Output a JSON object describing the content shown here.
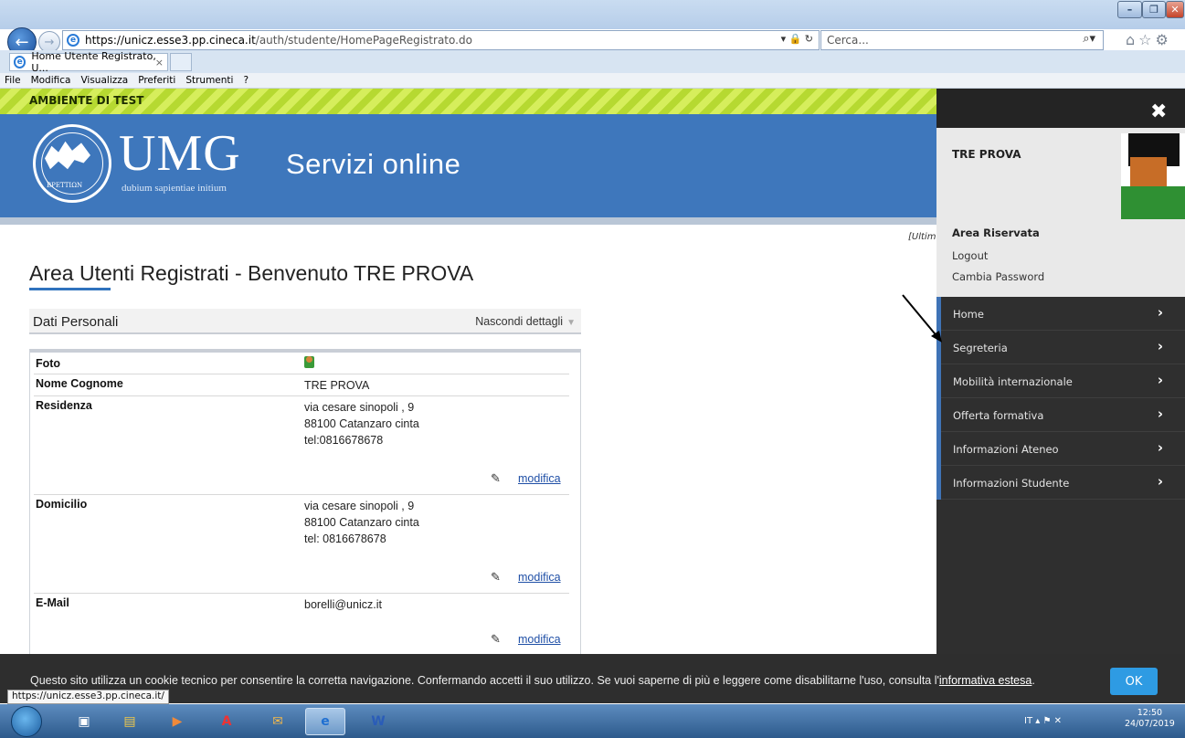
{
  "browser": {
    "url_prefix": "https://unicz.esse3.pp.",
    "url_domain": "cineca.it",
    "url_path": "/auth/studente/HomePageRegistrato.do",
    "search_placeholder": "Cerca...",
    "tab_title": "Home Utente Registrato, U...",
    "tab_close": "×",
    "menu": [
      "File",
      "Modifica",
      "Visualizza",
      "Preferiti",
      "Strumenti",
      "?"
    ],
    "status_url": "https://unicz.esse3.pp.cineca.it/"
  },
  "page": {
    "test_banner": "AMBIENTE DI TEST",
    "logo_text": "UMG",
    "logo_motto": "dubium sapientiae initium",
    "seal_text": "BPETTIΩN",
    "site_title": "Servizi online",
    "last_access_partial": "[Ultim",
    "heading": "Area Utenti Registrati - Benvenuto TRE PROVA",
    "section_title": "Dati Personali",
    "section_toggle": "Nascondi dettagli",
    "rows": {
      "foto": {
        "label": "Foto"
      },
      "nome": {
        "label": "Nome Cognome",
        "value": "TRE PROVA"
      },
      "residenza": {
        "label": "Residenza",
        "line1": "via cesare sinopoli , 9",
        "line2": "88100 Catanzaro cinta",
        "line3": "tel:0816678678",
        "edit": "modifica"
      },
      "domicilio": {
        "label": "Domicilio",
        "line1": "via cesare sinopoli , 9",
        "line2": "88100 Catanzaro cinta",
        "line3": "tel: 0816678678",
        "edit": "modifica"
      },
      "email": {
        "label": "E-Mail",
        "value": "borelli@unicz.it",
        "edit": "modifica"
      }
    }
  },
  "sidebar": {
    "close": "✖",
    "username": "TRE PROVA",
    "area_title": "Area Riservata",
    "logout": "Logout",
    "change_password": "Cambia Password",
    "items": [
      {
        "label": "Home"
      },
      {
        "label": "Segreteria"
      },
      {
        "label": "Mobilità internazionale"
      },
      {
        "label": "Offerta formativa"
      },
      {
        "label": "Informazioni Ateneo"
      },
      {
        "label": "Informazioni Studente"
      }
    ],
    "chevron": "›"
  },
  "cookie": {
    "text": "Questo sito utilizza un cookie tecnico per consentire la corretta navigazione. Confermando accetti il suo utilizzo. Se vuoi saperne di più e leggere come disabilitarne l'uso, consulta l'",
    "link": "informativa estesa",
    "suffix": ".",
    "ok": "OK"
  },
  "taskbar": {
    "language": "IT",
    "time": "12:50",
    "date": "24/07/2019"
  },
  "colors": {
    "header_blue": "#3e77bc",
    "accent_blue": "#2f72bd",
    "sidebar_dark": "#2f2f2f",
    "test_green": "#b6d931",
    "ok_blue": "#2e9be3"
  }
}
